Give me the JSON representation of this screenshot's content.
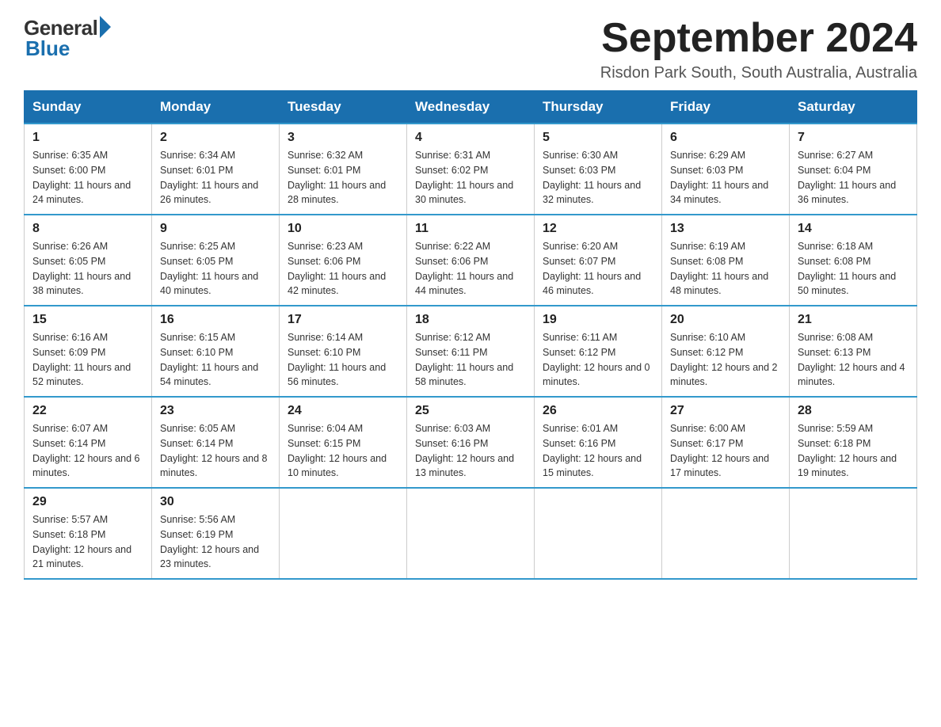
{
  "logo": {
    "general": "General",
    "blue": "Blue"
  },
  "title": {
    "month_year": "September 2024",
    "location": "Risdon Park South, South Australia, Australia"
  },
  "weekdays": [
    "Sunday",
    "Monday",
    "Tuesday",
    "Wednesday",
    "Thursday",
    "Friday",
    "Saturday"
  ],
  "weeks": [
    [
      {
        "day": "1",
        "sunrise": "6:35 AM",
        "sunset": "6:00 PM",
        "daylight": "11 hours and 24 minutes."
      },
      {
        "day": "2",
        "sunrise": "6:34 AM",
        "sunset": "6:01 PM",
        "daylight": "11 hours and 26 minutes."
      },
      {
        "day": "3",
        "sunrise": "6:32 AM",
        "sunset": "6:01 PM",
        "daylight": "11 hours and 28 minutes."
      },
      {
        "day": "4",
        "sunrise": "6:31 AM",
        "sunset": "6:02 PM",
        "daylight": "11 hours and 30 minutes."
      },
      {
        "day": "5",
        "sunrise": "6:30 AM",
        "sunset": "6:03 PM",
        "daylight": "11 hours and 32 minutes."
      },
      {
        "day": "6",
        "sunrise": "6:29 AM",
        "sunset": "6:03 PM",
        "daylight": "11 hours and 34 minutes."
      },
      {
        "day": "7",
        "sunrise": "6:27 AM",
        "sunset": "6:04 PM",
        "daylight": "11 hours and 36 minutes."
      }
    ],
    [
      {
        "day": "8",
        "sunrise": "6:26 AM",
        "sunset": "6:05 PM",
        "daylight": "11 hours and 38 minutes."
      },
      {
        "day": "9",
        "sunrise": "6:25 AM",
        "sunset": "6:05 PM",
        "daylight": "11 hours and 40 minutes."
      },
      {
        "day": "10",
        "sunrise": "6:23 AM",
        "sunset": "6:06 PM",
        "daylight": "11 hours and 42 minutes."
      },
      {
        "day": "11",
        "sunrise": "6:22 AM",
        "sunset": "6:06 PM",
        "daylight": "11 hours and 44 minutes."
      },
      {
        "day": "12",
        "sunrise": "6:20 AM",
        "sunset": "6:07 PM",
        "daylight": "11 hours and 46 minutes."
      },
      {
        "day": "13",
        "sunrise": "6:19 AM",
        "sunset": "6:08 PM",
        "daylight": "11 hours and 48 minutes."
      },
      {
        "day": "14",
        "sunrise": "6:18 AM",
        "sunset": "6:08 PM",
        "daylight": "11 hours and 50 minutes."
      }
    ],
    [
      {
        "day": "15",
        "sunrise": "6:16 AM",
        "sunset": "6:09 PM",
        "daylight": "11 hours and 52 minutes."
      },
      {
        "day": "16",
        "sunrise": "6:15 AM",
        "sunset": "6:10 PM",
        "daylight": "11 hours and 54 minutes."
      },
      {
        "day": "17",
        "sunrise": "6:14 AM",
        "sunset": "6:10 PM",
        "daylight": "11 hours and 56 minutes."
      },
      {
        "day": "18",
        "sunrise": "6:12 AM",
        "sunset": "6:11 PM",
        "daylight": "11 hours and 58 minutes."
      },
      {
        "day": "19",
        "sunrise": "6:11 AM",
        "sunset": "6:12 PM",
        "daylight": "12 hours and 0 minutes."
      },
      {
        "day": "20",
        "sunrise": "6:10 AM",
        "sunset": "6:12 PM",
        "daylight": "12 hours and 2 minutes."
      },
      {
        "day": "21",
        "sunrise": "6:08 AM",
        "sunset": "6:13 PM",
        "daylight": "12 hours and 4 minutes."
      }
    ],
    [
      {
        "day": "22",
        "sunrise": "6:07 AM",
        "sunset": "6:14 PM",
        "daylight": "12 hours and 6 minutes."
      },
      {
        "day": "23",
        "sunrise": "6:05 AM",
        "sunset": "6:14 PM",
        "daylight": "12 hours and 8 minutes."
      },
      {
        "day": "24",
        "sunrise": "6:04 AM",
        "sunset": "6:15 PM",
        "daylight": "12 hours and 10 minutes."
      },
      {
        "day": "25",
        "sunrise": "6:03 AM",
        "sunset": "6:16 PM",
        "daylight": "12 hours and 13 minutes."
      },
      {
        "day": "26",
        "sunrise": "6:01 AM",
        "sunset": "6:16 PM",
        "daylight": "12 hours and 15 minutes."
      },
      {
        "day": "27",
        "sunrise": "6:00 AM",
        "sunset": "6:17 PM",
        "daylight": "12 hours and 17 minutes."
      },
      {
        "day": "28",
        "sunrise": "5:59 AM",
        "sunset": "6:18 PM",
        "daylight": "12 hours and 19 minutes."
      }
    ],
    [
      {
        "day": "29",
        "sunrise": "5:57 AM",
        "sunset": "6:18 PM",
        "daylight": "12 hours and 21 minutes."
      },
      {
        "day": "30",
        "sunrise": "5:56 AM",
        "sunset": "6:19 PM",
        "daylight": "12 hours and 23 minutes."
      },
      null,
      null,
      null,
      null,
      null
    ]
  ]
}
